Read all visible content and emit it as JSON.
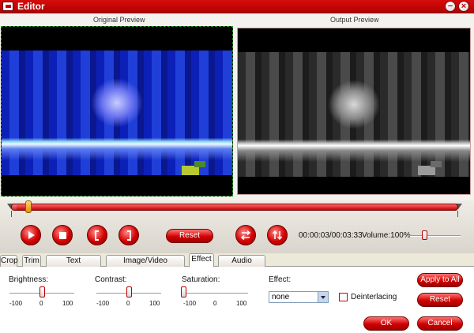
{
  "window": {
    "title": "Editor",
    "minimize_glyph": "−",
    "close_glyph": "×"
  },
  "preview": {
    "original_label": "Original Preview",
    "output_label": "Output Preview"
  },
  "timeline": {
    "progress_fraction": 0.01,
    "time_display": "00:00:03/00:03:33",
    "volume_label": "Volume:100%",
    "volume_fraction": 0.28,
    "reset_label": "Reset"
  },
  "playback_icons": [
    "play-icon",
    "stop-icon",
    "mark-in-icon",
    "mark-out-icon",
    "swap-horizontal-icon",
    "swap-vertical-icon"
  ],
  "tabs": [
    {
      "label": "Crop"
    },
    {
      "label": "Trim"
    },
    {
      "label": "Text Watermark"
    },
    {
      "label": "Image/Video Watermark"
    },
    {
      "label": "Effect"
    },
    {
      "label": "Audio Replace"
    }
  ],
  "effect_panel": {
    "brightness": {
      "label": "Brightness:",
      "min": "-100",
      "mid": "0",
      "max": "100",
      "value": 0
    },
    "contrast": {
      "label": "Contrast:",
      "min": "-100",
      "mid": "0",
      "max": "100",
      "value": 0
    },
    "saturation": {
      "label": "Saturation:",
      "min": "-100",
      "mid": "0",
      "max": "100",
      "value": -100
    },
    "effect": {
      "label": "Effect:",
      "selected": "none"
    },
    "deinterlacing": {
      "label": "Deinterlacing",
      "checked": false
    },
    "apply_to_all_label": "Apply to All",
    "reset_label": "Reset"
  },
  "dialog": {
    "ok_label": "OK",
    "cancel_label": "Cancel"
  },
  "colors": {
    "accent": "#cc0000",
    "tab_border": "#999999",
    "track": "#d40000"
  }
}
